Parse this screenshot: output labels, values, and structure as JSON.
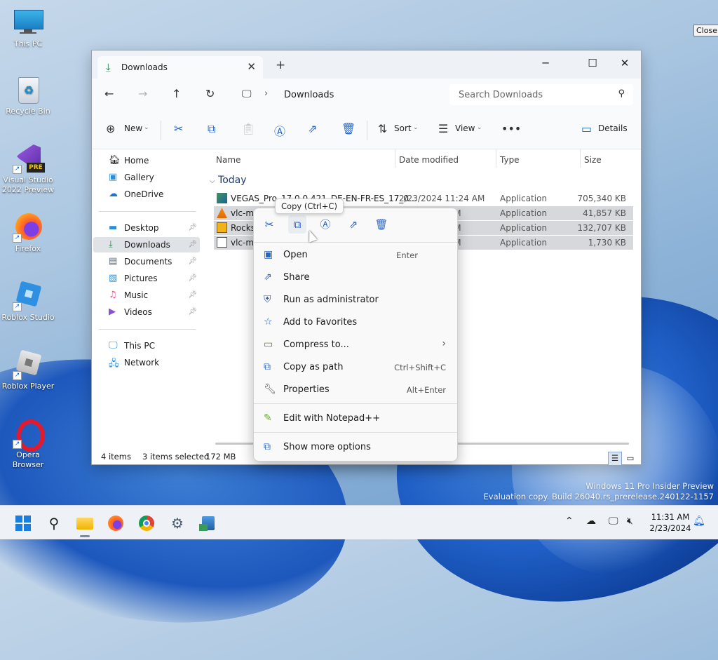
{
  "desktop": {
    "icons": [
      {
        "label": "This PC"
      },
      {
        "label": "Recycle Bin"
      },
      {
        "label": "Visual Studio 2022 Preview"
      },
      {
        "label": "Firefox"
      },
      {
        "label": "Roblox Studio"
      },
      {
        "label": "Roblox Player"
      },
      {
        "label": "Opera Browser"
      }
    ],
    "close_tooltip": "Close"
  },
  "window": {
    "tab_title": "Downloads",
    "new_tab": "+",
    "search_placeholder": "Search Downloads",
    "address": {
      "path": "Downloads"
    },
    "toolbar": {
      "new_label": "New",
      "sort_label": "Sort",
      "view_label": "View",
      "details_label": "Details"
    },
    "nav": [
      {
        "label": "Home"
      },
      {
        "label": "Gallery"
      },
      {
        "label": "OneDrive"
      },
      {
        "label": "Desktop"
      },
      {
        "label": "Downloads"
      },
      {
        "label": "Documents"
      },
      {
        "label": "Pictures"
      },
      {
        "label": "Music"
      },
      {
        "label": "Videos"
      },
      {
        "label": "This PC"
      },
      {
        "label": "Network"
      }
    ],
    "columns": {
      "name": "Name",
      "date": "Date modified",
      "type": "Type",
      "size": "Size"
    },
    "group": "Today",
    "files": [
      {
        "name": "VEGAS_Pro_17.0.0.421_DE-EN-FR-ES_17_0...",
        "date": "2/23/2024 11:24 AM",
        "type": "Application",
        "size": "705,340 KB"
      },
      {
        "name": "vlc-m",
        "date": "AM",
        "type": "Application",
        "size": "41,857 KB"
      },
      {
        "name": "Rocks",
        "date": "AM",
        "type": "Application",
        "size": "132,707 KB"
      },
      {
        "name": "vlc-m",
        "date": "AM",
        "type": "Application",
        "size": "1,730 KB"
      }
    ],
    "status": {
      "items": "4 items",
      "selected": "3 items selected",
      "size": "172 MB"
    }
  },
  "tooltip": "Copy (Ctrl+C)",
  "context_menu": {
    "items": [
      {
        "label": "Open",
        "shortcut": "Enter"
      },
      {
        "label": "Share",
        "shortcut": ""
      },
      {
        "label": "Run as administrator",
        "shortcut": ""
      },
      {
        "label": "Add to Favorites",
        "shortcut": ""
      },
      {
        "label": "Compress to...",
        "shortcut": ""
      },
      {
        "label": "Copy as path",
        "shortcut": "Ctrl+Shift+C"
      },
      {
        "label": "Properties",
        "shortcut": "Alt+Enter"
      },
      {
        "label": "Edit with Notepad++",
        "shortcut": ""
      },
      {
        "label": "Show more options",
        "shortcut": ""
      }
    ]
  },
  "watermark": {
    "line1": "Windows 11 Pro Insider Preview",
    "line2": "Evaluation copy. Build 26040.rs_prerelease.240122-1157"
  },
  "taskbar": {
    "time": "11:31 AM",
    "date": "2/23/2024"
  },
  "colors": {
    "accent": "#1e63c8",
    "selection": "#d6d8dc"
  }
}
